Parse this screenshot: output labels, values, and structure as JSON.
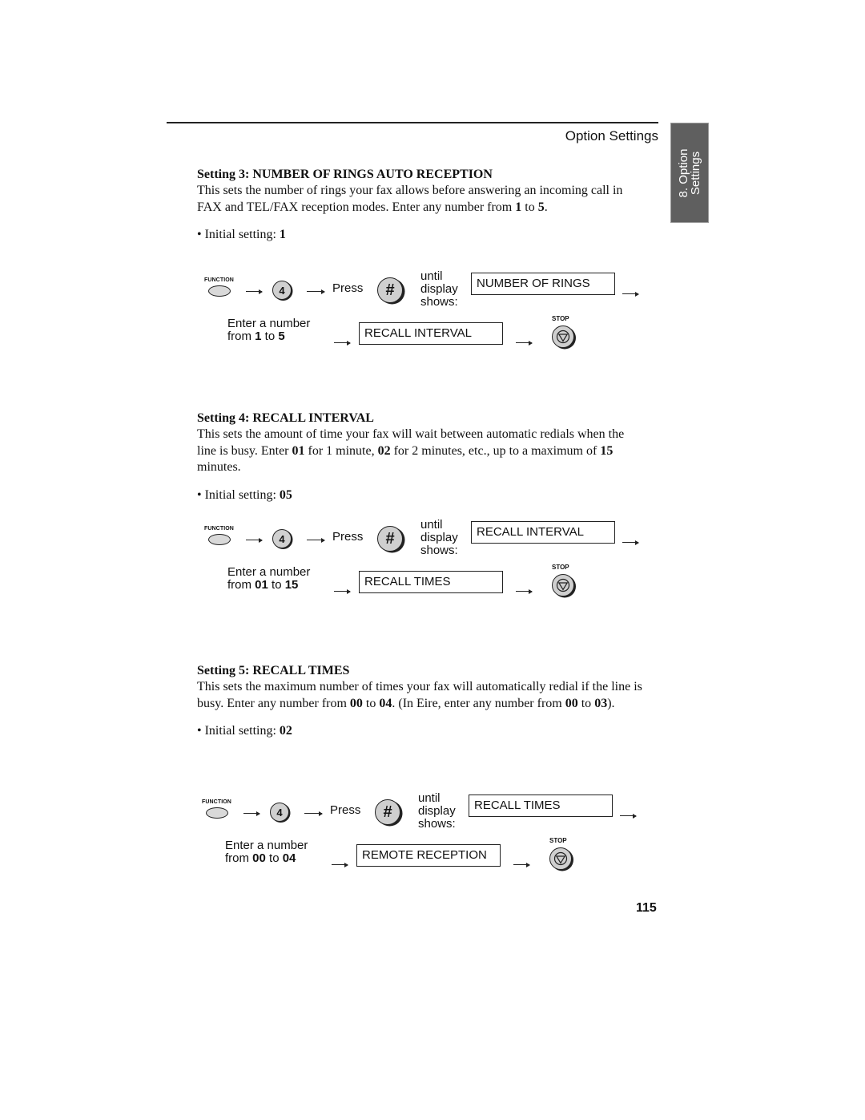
{
  "header": {
    "title": "Option Settings",
    "side_tab": {
      "line1": "8. Option",
      "line2": "Settings"
    }
  },
  "sections": [
    {
      "heading": "Setting 3: NUMBER OF RINGS AUTO RECEPTION",
      "body_parts": [
        {
          "text": "This sets the number of rings your fax allows before answering an incoming call in FAX and TEL/FAX reception modes. Enter any number from ",
          "bold": false
        },
        {
          "text": "1",
          "bold": true
        },
        {
          "text": " to ",
          "bold": false
        },
        {
          "text": "5",
          "bold": true
        },
        {
          "text": ".",
          "bold": false
        }
      ],
      "initial_label": "• Initial setting: ",
      "initial_value": "1",
      "flow": {
        "function_label": "FUNCTION",
        "key_digit": "4",
        "press_label": "Press",
        "hash_symbol": "#",
        "until_lines": [
          "until",
          "display",
          "shows:"
        ],
        "display_text": "NUMBER OF RINGS",
        "enter_line1": "Enter a number",
        "enter_from": "from ",
        "enter_min": "1",
        "enter_to": " to ",
        "enter_max": "5",
        "result_text": "RECALL INTERVAL",
        "stop_label": "STOP"
      }
    },
    {
      "heading": "Setting 4: RECALL INTERVAL",
      "body_parts": [
        {
          "text": "This sets the amount of time your fax will wait between automatic redials when the line is busy. Enter ",
          "bold": false
        },
        {
          "text": "01",
          "bold": true
        },
        {
          "text": " for 1 minute, ",
          "bold": false
        },
        {
          "text": "02",
          "bold": true
        },
        {
          "text": " for 2 minutes, etc., up to a maximum of ",
          "bold": false
        },
        {
          "text": "15",
          "bold": true
        },
        {
          "text": " minutes.",
          "bold": false
        }
      ],
      "initial_label": "• Initial setting: ",
      "initial_value": "05",
      "flow": {
        "function_label": "FUNCTION",
        "key_digit": "4",
        "press_label": "Press",
        "hash_symbol": "#",
        "until_lines": [
          "until",
          "display",
          "shows:"
        ],
        "display_text": "RECALL INTERVAL",
        "enter_line1": "Enter a number",
        "enter_from": "from ",
        "enter_min": "01",
        "enter_to": " to ",
        "enter_max": "15",
        "result_text": "RECALL TIMES",
        "stop_label": "STOP"
      }
    },
    {
      "heading": "Setting 5: RECALL TIMES",
      "body_parts": [
        {
          "text": "This sets the maximum number of times your fax will automatically redial if the line is busy. Enter any number from ",
          "bold": false
        },
        {
          "text": "00",
          "bold": true
        },
        {
          "text": " to ",
          "bold": false
        },
        {
          "text": "04",
          "bold": true
        },
        {
          "text": ". (In Eire, enter any number from ",
          "bold": false
        },
        {
          "text": "00",
          "bold": true
        },
        {
          "text": " to ",
          "bold": false
        },
        {
          "text": "03",
          "bold": true
        },
        {
          "text": ").",
          "bold": false
        }
      ],
      "initial_label": "• Initial setting: ",
      "initial_value": "02",
      "flow": {
        "function_label": "FUNCTION",
        "key_digit": "4",
        "press_label": "Press",
        "hash_symbol": "#",
        "until_lines": [
          "until",
          "display",
          "shows:"
        ],
        "display_text": "RECALL TIMES",
        "enter_line1": "Enter a number",
        "enter_from": "from ",
        "enter_min": "00",
        "enter_to": " to ",
        "enter_max": "04",
        "result_text": "REMOTE RECEPTION",
        "stop_label": "STOP"
      }
    }
  ],
  "page_number": "115"
}
